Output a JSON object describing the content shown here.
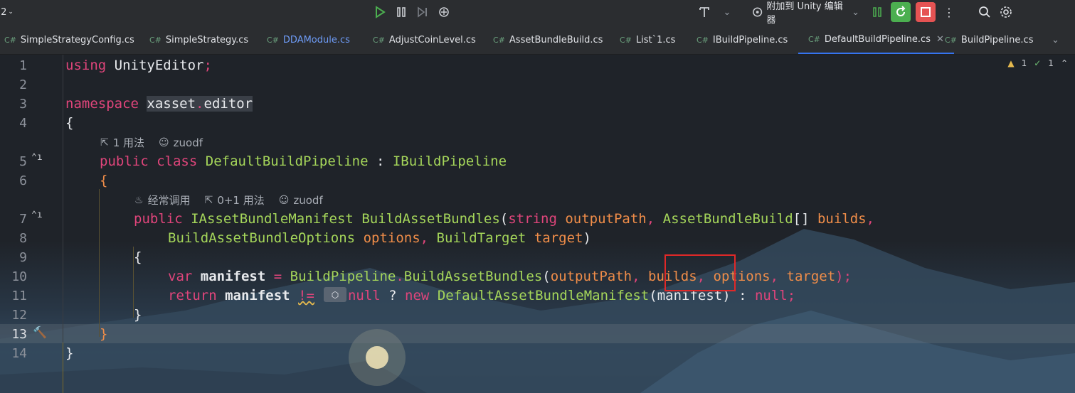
{
  "toolbar": {
    "left_label": "2",
    "attach_label": "附加到 Unity 编辑器",
    "colors": {
      "run_green": "#4caf50",
      "stop_red": "#e55353"
    }
  },
  "tabs": [
    {
      "label": "SimpleStrategyConfig.cs"
    },
    {
      "label": "SimpleStrategy.cs"
    },
    {
      "label": "DDAModule.cs"
    },
    {
      "label": "AdjustCoinLevel.cs"
    },
    {
      "label": "AssetBundleBuild.cs"
    },
    {
      "label": "List`1.cs"
    },
    {
      "label": "IBuildPipeline.cs"
    },
    {
      "label": "DefaultBuildPipeline.cs",
      "active": true
    },
    {
      "label": "BuildPipeline.cs"
    }
  ],
  "tab_prefix": "C#",
  "inspections": {
    "warnings": "1",
    "typos": "1"
  },
  "hints": {
    "class_usages": "1 用法",
    "class_author": "zuodf",
    "method_frequent": "经常调用",
    "method_usages": "0+1 用法",
    "method_author": "zuodf"
  },
  "line_numbers": [
    "1",
    "2",
    "3",
    "4",
    "5",
    "6",
    "7",
    "8",
    "9",
    "10",
    "11",
    "12",
    "13",
    "14"
  ],
  "code": {
    "l1_kw": "using",
    "l1_ns": "UnityEditor",
    "l1_semi": ";",
    "l3_kw": "namespace",
    "l3_ns1": "xasset",
    "l3_dot": ".",
    "l3_ns2": "editor",
    "l4": "{",
    "l5_kw1": "public",
    "l5_kw2": "class",
    "l5_name": "DefaultBuildPipeline",
    "l5_colon": " : ",
    "l5_base": "IBuildPipeline",
    "l6": "{",
    "l7_kw": "public",
    "l7_ret": "IAssetBundleManifest",
    "l7_name": "BuildAssetBundles",
    "l7_open": "(",
    "l7_t1": "string",
    "l7_p1": "outputPath",
    "l7_comma1": ", ",
    "l7_t2": "AssetBundleBuild",
    "l7_arr": "[] ",
    "l7_p2": "builds",
    "l7_comma2": ",",
    "l8_t3": "BuildAssetBundleOptions",
    "l8_p3": "options",
    "l8_comma": ", ",
    "l8_t4": "BuildTarget",
    "l8_p4": "target",
    "l8_close": ")",
    "l9": "{",
    "l10_kw": "var",
    "l10_var": "manifest",
    "l10_eq": " = ",
    "l10_cls": "BuildPipeline",
    "l10_dot": ".",
    "l10_m": "BuildAssetBundles",
    "l10_open": "(",
    "l10_a1": "outputPath",
    "l10_c1": ", ",
    "l10_a2": "builds",
    "l10_c2": ", ",
    "l10_a3": "options",
    "l10_c3": ", ",
    "l10_a4": "target",
    "l10_end": ");",
    "l11_kw": "return",
    "l11_var": "manifest",
    "l11_op": "!=",
    "l11_null": "null",
    "l11_q": " ? ",
    "l11_new": "new",
    "l11_cls": "DefaultAssetBundleManifest",
    "l11_arg": "(manifest)",
    "l11_colon": " : ",
    "l11_null2": "null",
    "l11_semi": ";",
    "l12": "}",
    "l13": "}",
    "l14": "}"
  }
}
